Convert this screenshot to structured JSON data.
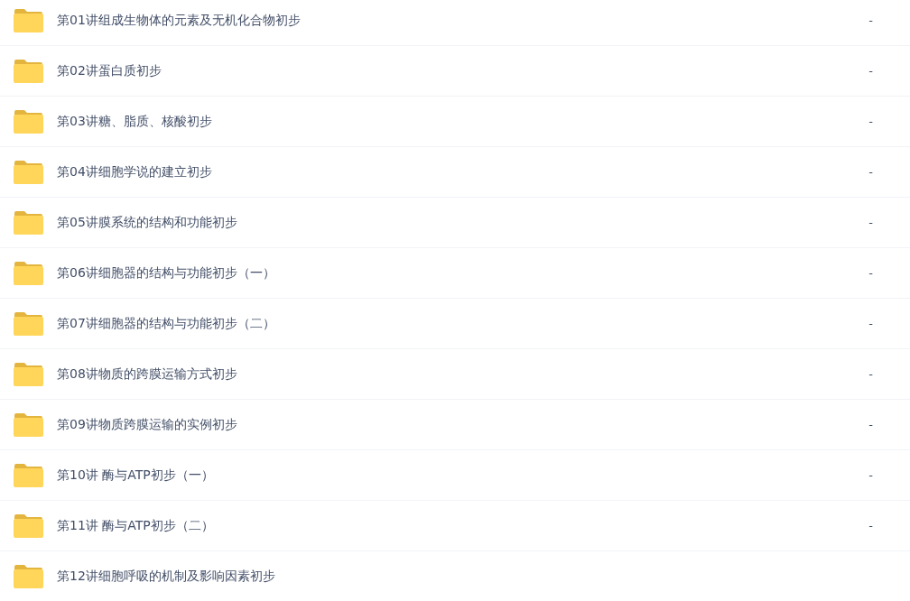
{
  "files": [
    {
      "name": "第01讲组成生物体的元素及无机化合物初步",
      "size": "-"
    },
    {
      "name": "第02讲蛋白质初步",
      "size": "-"
    },
    {
      "name": "第03讲糖、脂质、核酸初步",
      "size": "-"
    },
    {
      "name": "第04讲细胞学说的建立初步",
      "size": "-"
    },
    {
      "name": "第05讲膜系统的结构和功能初步",
      "size": "-"
    },
    {
      "name": "第06讲细胞器的结构与功能初步（一）",
      "size": "-"
    },
    {
      "name": "第07讲细胞器的结构与功能初步（二）",
      "size": "-"
    },
    {
      "name": "第08讲物质的跨膜运输方式初步",
      "size": "-"
    },
    {
      "name": "第09讲物质跨膜运输的实例初步",
      "size": "-"
    },
    {
      "name": "第10讲 酶与ATP初步（一）",
      "size": "-"
    },
    {
      "name": "第11讲 酶与ATP初步（二）",
      "size": "-"
    },
    {
      "name": "第12讲细胞呼吸的机制及影响因素初步"
    }
  ]
}
